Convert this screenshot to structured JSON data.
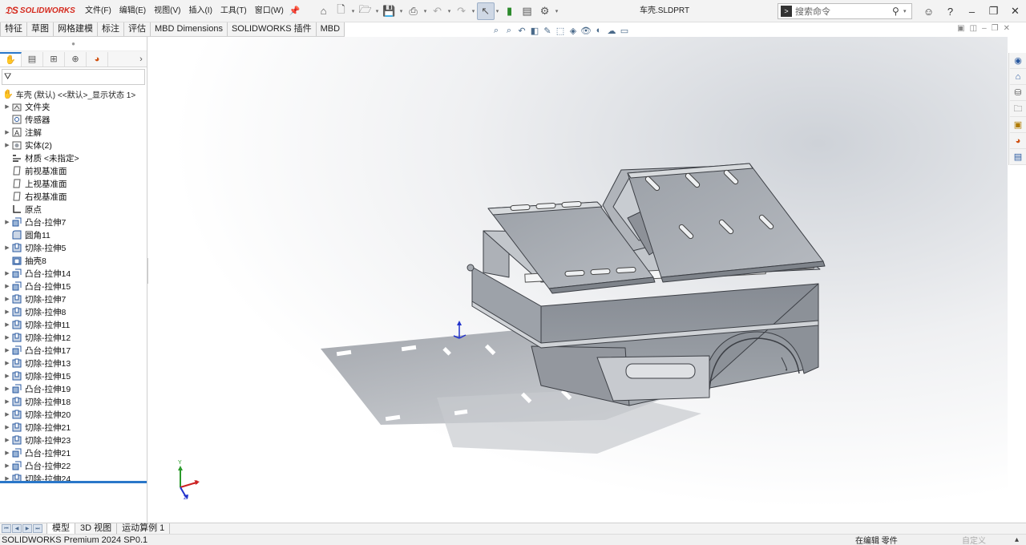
{
  "app": {
    "logo_text": "SOLIDWORKS",
    "document_title": "车壳.SLDPRT",
    "menus": [
      "文件(F)",
      "编辑(E)",
      "视图(V)",
      "插入(I)",
      "工具(T)",
      "窗口(W)"
    ],
    "search_placeholder": "搜索命令"
  },
  "command_tabs": [
    "特征",
    "草图",
    "网格建模",
    "标注",
    "评估",
    "MBD Dimensions",
    "SOLIDWORKS 插件",
    "MBD"
  ],
  "feature_tree": {
    "root": "车壳 (默认) <<默认>_显示状态 1>",
    "nodes": [
      {
        "label": "文件夹",
        "expandable": true,
        "icon": "folder"
      },
      {
        "label": "传感器",
        "expandable": false,
        "icon": "sensor"
      },
      {
        "label": "注解",
        "expandable": true,
        "icon": "annotation"
      },
      {
        "label": "实体(2)",
        "expandable": true,
        "icon": "solid-body"
      },
      {
        "label": "材质 <未指定>",
        "expandable": false,
        "icon": "material"
      },
      {
        "label": "前视基准面",
        "expandable": false,
        "icon": "plane"
      },
      {
        "label": "上视基准面",
        "expandable": false,
        "icon": "plane"
      },
      {
        "label": "右视基准面",
        "expandable": false,
        "icon": "plane"
      },
      {
        "label": "原点",
        "expandable": false,
        "icon": "origin"
      },
      {
        "label": "凸台-拉伸7",
        "expandable": true,
        "icon": "boss-extrude"
      },
      {
        "label": "圆角11",
        "expandable": false,
        "icon": "fillet"
      },
      {
        "label": "切除-拉伸5",
        "expandable": true,
        "icon": "cut-extrude"
      },
      {
        "label": "抽壳8",
        "expandable": false,
        "icon": "shell"
      },
      {
        "label": "凸台-拉伸14",
        "expandable": true,
        "icon": "boss-extrude"
      },
      {
        "label": "凸台-拉伸15",
        "expandable": true,
        "icon": "boss-extrude"
      },
      {
        "label": "切除-拉伸7",
        "expandable": true,
        "icon": "cut-extrude"
      },
      {
        "label": "切除-拉伸8",
        "expandable": true,
        "icon": "cut-extrude"
      },
      {
        "label": "切除-拉伸11",
        "expandable": true,
        "icon": "cut-extrude"
      },
      {
        "label": "切除-拉伸12",
        "expandable": true,
        "icon": "cut-extrude"
      },
      {
        "label": "凸台-拉伸17",
        "expandable": true,
        "icon": "boss-extrude"
      },
      {
        "label": "切除-拉伸13",
        "expandable": true,
        "icon": "cut-extrude"
      },
      {
        "label": "切除-拉伸15",
        "expandable": true,
        "icon": "cut-extrude"
      },
      {
        "label": "凸台-拉伸19",
        "expandable": true,
        "icon": "boss-extrude"
      },
      {
        "label": "切除-拉伸18",
        "expandable": true,
        "icon": "cut-extrude"
      },
      {
        "label": "切除-拉伸20",
        "expandable": true,
        "icon": "cut-extrude"
      },
      {
        "label": "切除-拉伸21",
        "expandable": true,
        "icon": "cut-extrude"
      },
      {
        "label": "切除-拉伸23",
        "expandable": true,
        "icon": "cut-extrude"
      },
      {
        "label": "凸台-拉伸21",
        "expandable": true,
        "icon": "boss-extrude"
      },
      {
        "label": "凸台-拉伸22",
        "expandable": true,
        "icon": "boss-extrude"
      },
      {
        "label": "切除-拉伸24",
        "expandable": true,
        "icon": "cut-extrude"
      }
    ]
  },
  "triad": {
    "x_label": "X",
    "y_label": "Y",
    "z_label": "Z"
  },
  "bottom_tabs": [
    "模型",
    "3D 视图",
    "运动算例 1"
  ],
  "status": {
    "version": "SOLIDWORKS Premium 2024 SP0.1",
    "editing": "在编辑 零件",
    "custom": "自定义"
  },
  "colors": {
    "brand": "#d52a1e",
    "accent": "#2a77c9",
    "model_gray": "#8e939c"
  }
}
